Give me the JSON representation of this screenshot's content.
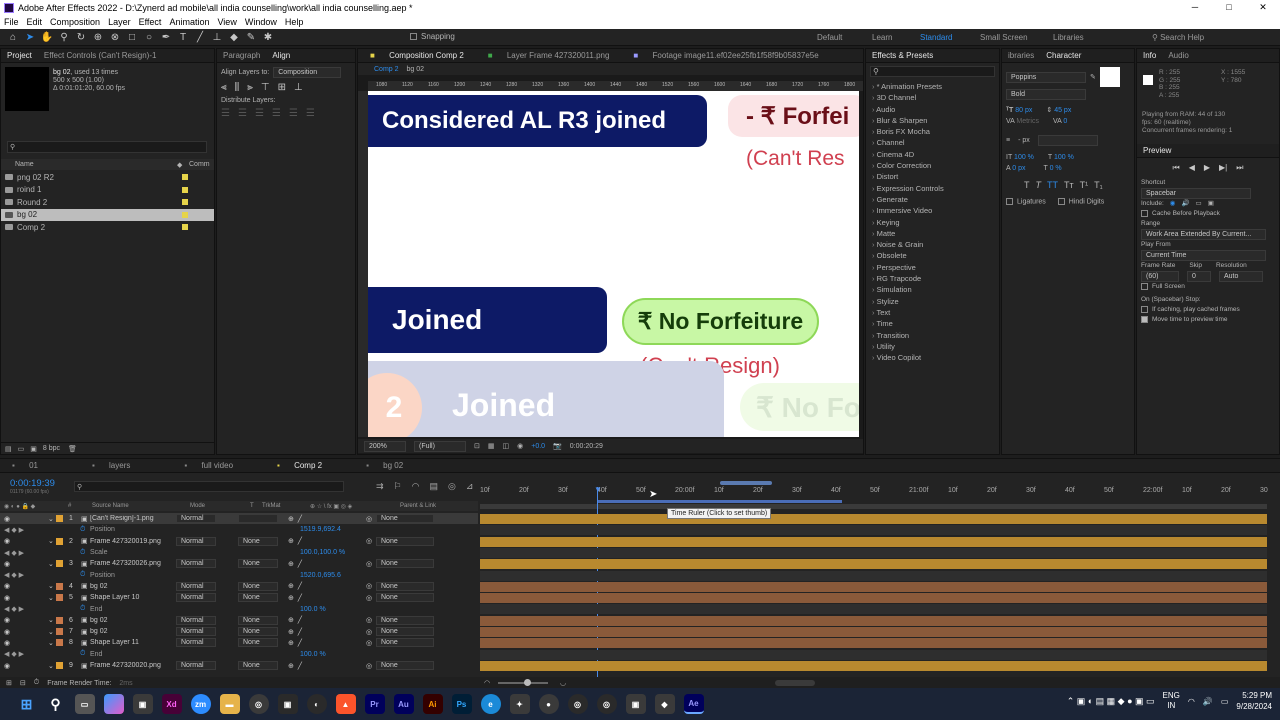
{
  "window": {
    "title": "Adobe After Effects 2022 - D:\\Zynerd ad mobile\\all india counselling\\work\\all india counselling.aep *",
    "controls": [
      "─",
      "□",
      "✕"
    ]
  },
  "menu": [
    "File",
    "Edit",
    "Composition",
    "Layer",
    "Effect",
    "Animation",
    "View",
    "Window",
    "Help"
  ],
  "toolbar": {
    "snapping": "Snapping",
    "workspaces": [
      "Default",
      "Learn",
      "Standard",
      "Small Screen",
      "Libraries"
    ],
    "search_help": "Search Help"
  },
  "project": {
    "tab": "Project",
    "effect_controls_tab": "Effect Controls (Can't Resign)-1",
    "selected_name": "bg 02",
    "selected_used": ", used 13 times",
    "selected_dims": "500 x 500 (1.00)",
    "selected_duration": "Δ 0:01:01:20, 60.00 fps",
    "col_name": "Name",
    "col_comment": "Comm",
    "items": [
      {
        "name": "png 02 R2",
        "type": "folder",
        "color": "#e6d44a"
      },
      {
        "name": "roind 1",
        "type": "folder",
        "color": "#e6d44a"
      },
      {
        "name": "Round 2",
        "type": "folder",
        "color": "#e6d44a"
      },
      {
        "name": "bg 02",
        "type": "comp",
        "color": "#e6d44a",
        "selected": true
      },
      {
        "name": "Comp 2",
        "type": "comp",
        "color": "#e6d44a"
      }
    ],
    "bpc": "8 bpc"
  },
  "align": {
    "tabs": [
      "Paragraph",
      "Align"
    ],
    "align_to_label": "Align Layers to:",
    "align_to_value": "Composition",
    "distribute_label": "Distribute Layers:"
  },
  "composition": {
    "tabs": [
      "Composition Comp 2",
      "Layer Frame 427320011.png",
      "Footage image11.ef02ee25fb1f58f9b05837e5e"
    ],
    "breadcrumbs": [
      "Comp 2",
      "bg 02"
    ],
    "ruler": [
      "1080",
      "1120",
      "1160",
      "1200",
      "1240",
      "1280",
      "1320",
      "1360",
      "1400",
      "1440",
      "1480",
      "1520",
      "1560",
      "1600",
      "1640",
      "1680",
      "1720",
      "1760",
      "1800"
    ],
    "cards": {
      "top_main": "Considered AL R3 joined",
      "top_forfeit": "- ₹ Forfei",
      "top_cant": "(Can't Res",
      "mid_main": "Joined",
      "mid_forfeit": "₹ No Forfeiture",
      "mid_cant": "(Can't Resign)",
      "bot_num": "2",
      "bot_main": "Joined",
      "bot_forfeit": "₹ No Fo"
    },
    "footer": {
      "zoom": "200%",
      "resolution": "(Full)",
      "exposure": "+0.0",
      "timecode": "0:00:20:29"
    }
  },
  "effects": {
    "tab": "Effects & Presets",
    "search_placeholder": "",
    "items": [
      "* Animation Presets",
      "3D Channel",
      "Audio",
      "Blur & Sharpen",
      "Boris FX Mocha",
      "Channel",
      "Cinema 4D",
      "Color Correction",
      "Distort",
      "Expression Controls",
      "Generate",
      "Immersive Video",
      "Keying",
      "Matte",
      "Noise & Grain",
      "Obsolete",
      "Perspective",
      "RG Trapcode",
      "Simulation",
      "Stylize",
      "Text",
      "Time",
      "Transition",
      "Utility",
      "Video Copilot"
    ]
  },
  "character": {
    "tabs": [
      "ibraries",
      "Character"
    ],
    "font": "Poppins",
    "style": "Bold",
    "size": "80 px",
    "leading": "45 px",
    "kerning": "Metrics",
    "tracking": "0",
    "stroke": "- px",
    "vscale": "100 %",
    "hscale": "100 %",
    "baseline": "0 px",
    "tsume": "0 %",
    "ligatures": "Ligatures",
    "hindi": "Hindi Digits"
  },
  "info": {
    "tabs": [
      "Info",
      "Audio"
    ],
    "r": "R : 255",
    "g": "G : 255",
    "b": "B : 255",
    "a": "A : 255",
    "x": "X : 1555",
    "y": "Y : 780",
    "playing": "Playing from RAM: 44 of 130",
    "fps": "fps: 60 (realtime)",
    "concurrent": "Concurrent frames rendering: 1"
  },
  "preview": {
    "tab": "Preview",
    "shortcut_label": "Shortcut",
    "shortcut": "Spacebar",
    "include_label": "Include:",
    "cache_before": "Cache Before Playback",
    "range_label": "Range",
    "range": "Work Area Extended By Current...",
    "play_from_label": "Play From",
    "play_from": "Current Time",
    "frame_rate_label": "Frame Rate",
    "skip_label": "Skip",
    "resolution_label": "Resolution",
    "frame_rate": "(60)",
    "skip": "0",
    "resolution": "Auto",
    "full_screen": "Full Screen",
    "on_stop": "On (Spacebar) Stop:",
    "if_caching": "If caching, play cached frames",
    "move_time": "Move time to preview time"
  },
  "timeline": {
    "tabs": [
      "01",
      "layers",
      "full video",
      "Comp 2",
      "bg 02"
    ],
    "timecode": "0:00:19:39",
    "timecode_sub": "01179 (60.00 fps)",
    "ruler": [
      "10f",
      "20f",
      "30f",
      "40f",
      "50f",
      "20:00f",
      "10f",
      "20f",
      "30f",
      "40f",
      "50f",
      "21:00f",
      "10f",
      "20f",
      "30f",
      "40f",
      "50f",
      "22:00f",
      "10f",
      "20f",
      "30"
    ],
    "headers": {
      "num": "#",
      "source": "Source Name",
      "mode": "Mode",
      "t": "T",
      "trkmat": "TrkMat",
      "switches": "⊕ ☆ \\ fx ▣ ◎ ◈",
      "parent": "Parent & Link"
    },
    "tooltip": "Time Ruler (Click to set thumb)",
    "footer": "Frame Render Time:",
    "footer_value": "2ms",
    "rows": [
      {
        "num": "1",
        "name": "[Can't Resign]-1.png",
        "mode": "Normal",
        "trk": "",
        "parent": "None",
        "color": "#e0a234",
        "type": "layer",
        "selected": true
      },
      {
        "name": "Position",
        "value": "1519.9,692.4",
        "type": "prop"
      },
      {
        "num": "2",
        "name": "Frame 427320019.png",
        "mode": "Normal",
        "trk": "None",
        "parent": "None",
        "color": "#e0a234",
        "type": "layer"
      },
      {
        "name": "Scale",
        "value": "100.0,100.0 %",
        "type": "prop"
      },
      {
        "num": "3",
        "name": "Frame 427320026.png",
        "mode": "Normal",
        "trk": "None",
        "parent": "None",
        "color": "#e0a234",
        "type": "layer"
      },
      {
        "name": "Position",
        "value": "1520.0,695.6",
        "type": "prop"
      },
      {
        "num": "4",
        "name": "bg 02",
        "mode": "Normal",
        "trk": "None",
        "parent": "None",
        "color": "#c9784a",
        "type": "layer"
      },
      {
        "num": "5",
        "name": "Shape Layer 10",
        "mode": "Normal",
        "trk": "None",
        "parent": "None",
        "color": "#c9784a",
        "type": "layer"
      },
      {
        "name": "End",
        "value": "100.0 %",
        "type": "prop"
      },
      {
        "num": "6",
        "name": "bg 02",
        "mode": "Normal",
        "trk": "None",
        "parent": "None",
        "color": "#c9784a",
        "type": "layer"
      },
      {
        "num": "7",
        "name": "bg 02",
        "mode": "Normal",
        "trk": "None",
        "parent": "None",
        "color": "#c9784a",
        "type": "layer"
      },
      {
        "num": "8",
        "name": "Shape Layer 11",
        "mode": "Normal",
        "trk": "None",
        "parent": "None",
        "color": "#c9784a",
        "type": "layer"
      },
      {
        "name": "End",
        "value": "100.0 %",
        "type": "prop"
      },
      {
        "num": "9",
        "name": "Frame 427320020.png",
        "mode": "Normal",
        "trk": "None",
        "parent": "None",
        "color": "#e0a234",
        "type": "layer"
      }
    ]
  },
  "taskbar": {
    "apps": [
      "Xd",
      "zm",
      "Pr",
      "Au",
      "Ai",
      "Ps",
      "Ae"
    ],
    "lang": "ENG",
    "region": "IN",
    "time": "5:29 PM",
    "date": "9/28/2024"
  }
}
